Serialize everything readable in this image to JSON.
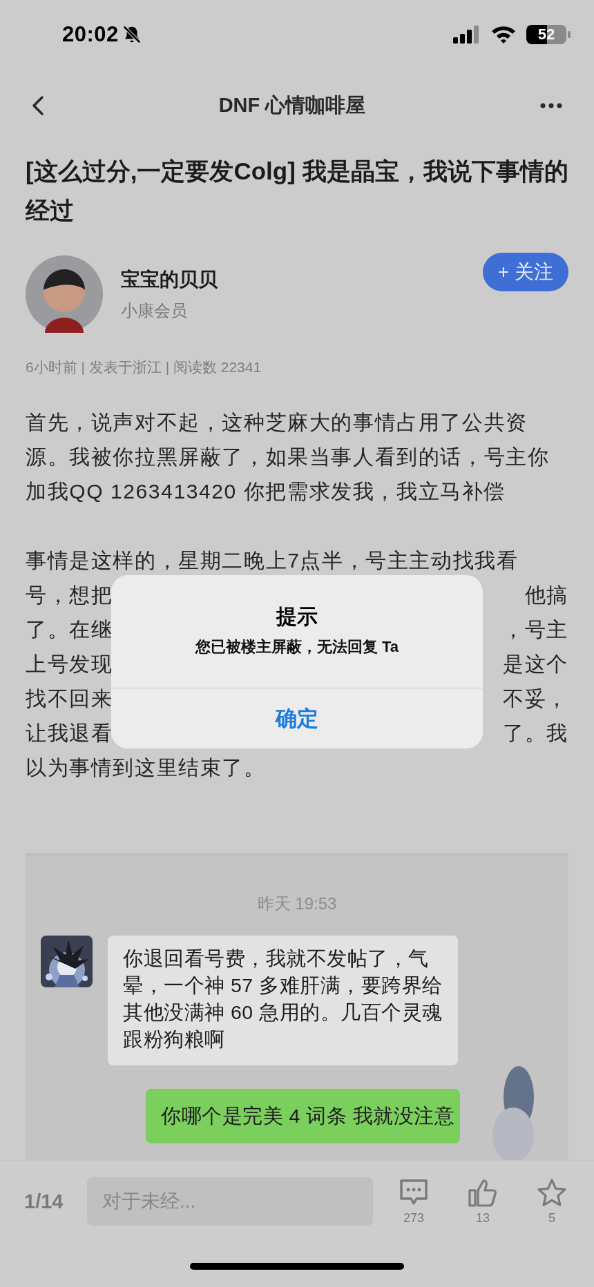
{
  "status_bar": {
    "time": "20:02",
    "battery": "52"
  },
  "nav": {
    "title": "DNF 心情咖啡屋"
  },
  "post": {
    "title": "[这么过分,一定要发Colg] 我是晶宝，我说下事情的经过",
    "author": {
      "name": "宝宝的贝贝",
      "rank": "小康会员",
      "follow_label": "+ 关注"
    },
    "meta": "6小时前 | 发表于浙江 | 阅读数 22341",
    "paragraphs": [
      {
        "lines": [
          [
            "首先，说声对不起，这种芝麻大的事情占用了公共资"
          ],
          [
            "源。我被你拉黑屏蔽了，如果当事人看到的话，号主你"
          ],
          [
            "加我QQ 1263413420 你把需求发我，我立马补偿"
          ]
        ]
      },
      {
        "lines": [
          [
            "事情是这样的，星期二晚上7点半，号主主动找我看"
          ],
          [
            "号，想把",
            "他搞"
          ],
          [
            "了。在继",
            "，号主"
          ],
          [
            "上号发现",
            "是这个"
          ],
          [
            "找不回来",
            "不妥，"
          ],
          [
            "让我退看",
            "了。我"
          ],
          [
            "以为事情到这里结束了。"
          ]
        ]
      }
    ],
    "chat": {
      "timestamp": "昨天 19:53",
      "messages": [
        {
          "kind": "received",
          "lines": [
            "你退回看号费，我就不发帖了，气",
            "晕，一个神 57 多难肝满，要跨界给",
            "其他没满神 60 急用的。几百个灵魂",
            "跟粉狗粮啊"
          ]
        },
        {
          "kind": "sent",
          "lines": [
            "你哪个是完美 4 词条 我就没注意"
          ]
        }
      ]
    }
  },
  "dialog": {
    "title": "提示",
    "message": "您已被楼主屏蔽，无法回复 Ta",
    "button": "确定"
  },
  "bottom_bar": {
    "page": "1/14",
    "comment_placeholder": "对于未经...",
    "actions": [
      {
        "kind": "comment",
        "count": "273"
      },
      {
        "kind": "like",
        "count": "13"
      },
      {
        "kind": "favorite",
        "count": "5"
      }
    ]
  }
}
